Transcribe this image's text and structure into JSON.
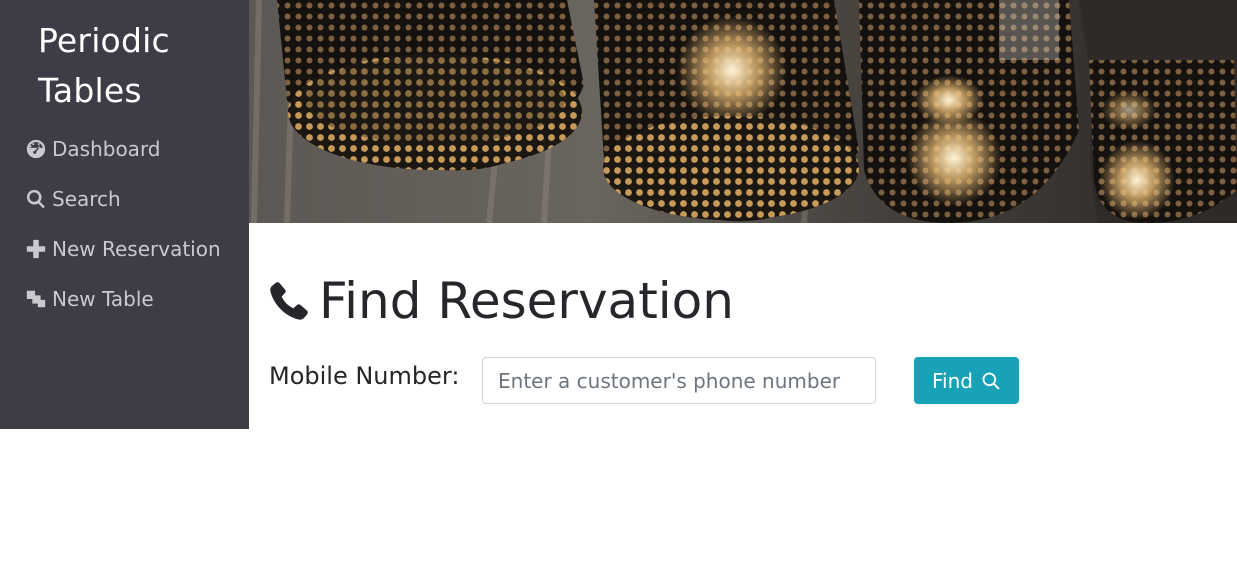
{
  "sidebar": {
    "brand_line1": "Periodic",
    "brand_line2": "Tables",
    "background": "#3d3c47",
    "items": [
      {
        "label": "Dashboard",
        "icon": "dashboard-icon"
      },
      {
        "label": "Search",
        "icon": "search-icon"
      },
      {
        "label": "New Reservation",
        "icon": "plus-icon"
      },
      {
        "label": "New Table",
        "icon": "layers-icon"
      }
    ]
  },
  "hero": {
    "image": "pendant-lamps-banner"
  },
  "main": {
    "title": "Find Reservation",
    "title_icon": "phone-icon",
    "form": {
      "label": "Mobile Number:",
      "placeholder": "Enter a customer's phone number",
      "value": "",
      "button_label": "Find",
      "button_icon": "search-icon",
      "button_color": "#17a2b8"
    }
  }
}
